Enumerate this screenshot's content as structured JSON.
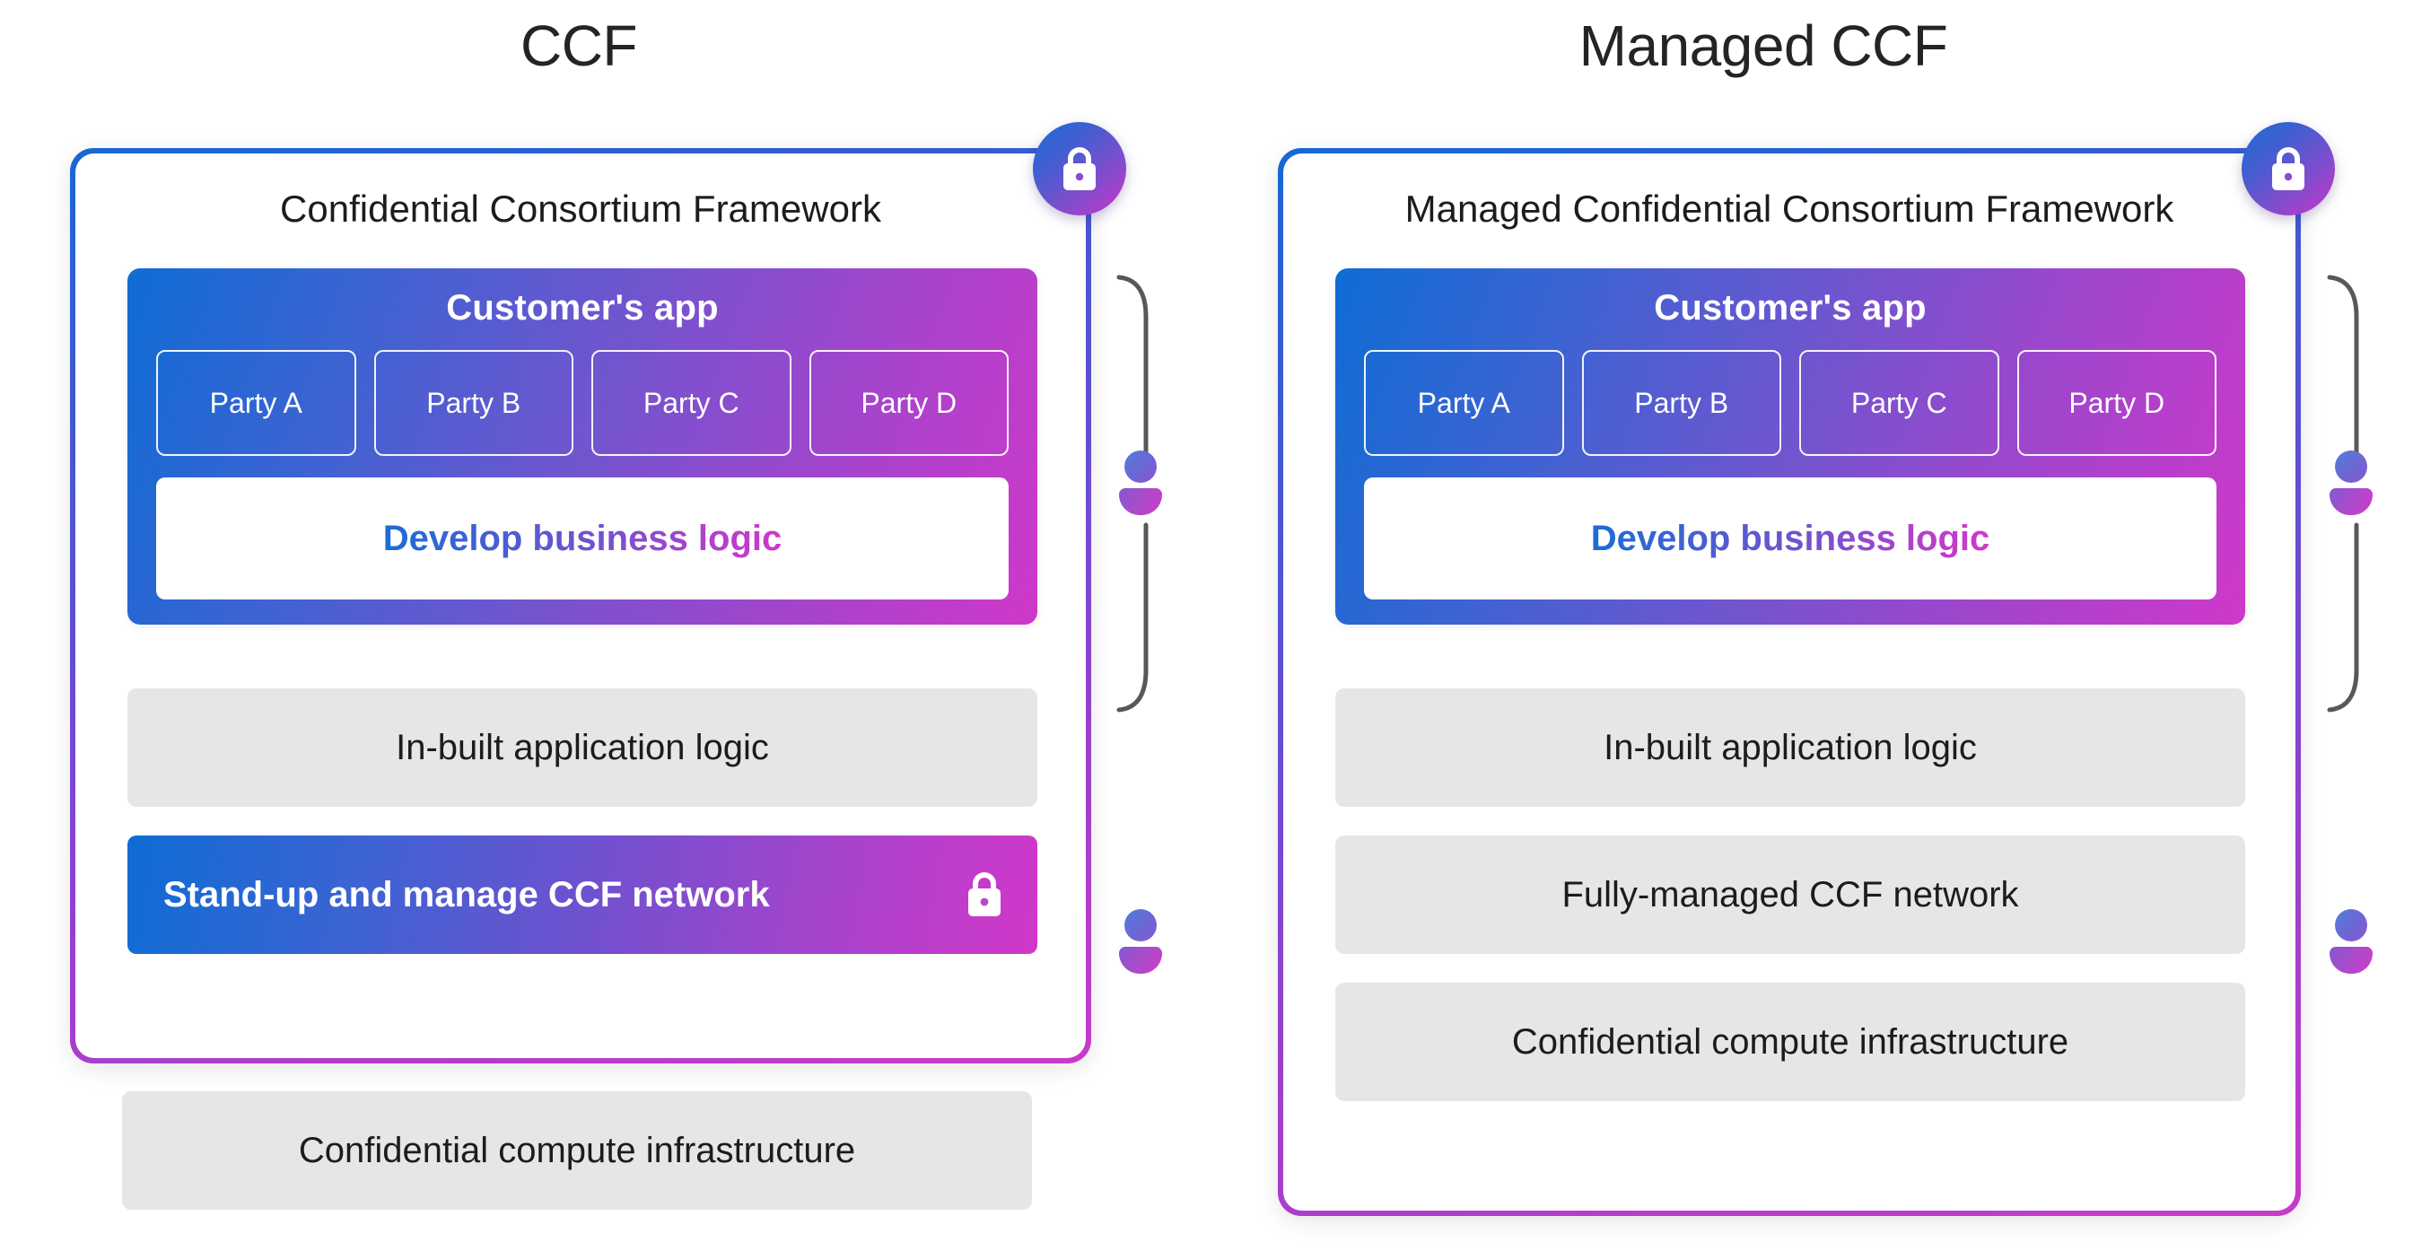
{
  "columns": {
    "left": {
      "title": "CCF",
      "framework_heading": "Confidential Consortium Framework",
      "customer_app": {
        "title": "Customer's app",
        "parties": [
          "Party A",
          "Party B",
          "Party C",
          "Party D"
        ],
        "develop_label": "Develop business logic"
      },
      "layers": [
        {
          "label": "In-built application logic",
          "style": "grey"
        },
        {
          "label": "Stand-up and manage CCF network",
          "style": "gradient",
          "icon": "lock-icon"
        }
      ],
      "outside_layer": {
        "label": "Confidential compute infrastructure",
        "style": "grey"
      }
    },
    "right": {
      "title": "Managed CCF",
      "framework_heading": "Managed Confidential Consortium Framework",
      "customer_app": {
        "title": "Customer's app",
        "parties": [
          "Party A",
          "Party B",
          "Party C",
          "Party D"
        ],
        "develop_label": "Develop business logic"
      },
      "layers": [
        {
          "label": "In-built application logic",
          "style": "grey"
        },
        {
          "label": "Fully-managed CCF network",
          "style": "grey"
        },
        {
          "label": "Confidential compute infrastructure",
          "style": "grey"
        }
      ]
    }
  },
  "icons": {
    "panel_badge": "lock-icon",
    "responsibility_marker": "person-icon",
    "bracket": "curly-brace-icon"
  },
  "colors": {
    "gradient_start": "#0f6cd4",
    "gradient_mid": "#7250cf",
    "gradient_end": "#cf38c9",
    "grey_layer": "#e6e6e6",
    "text_dark": "#1c1c1c",
    "bracket_stroke": "#585858"
  }
}
